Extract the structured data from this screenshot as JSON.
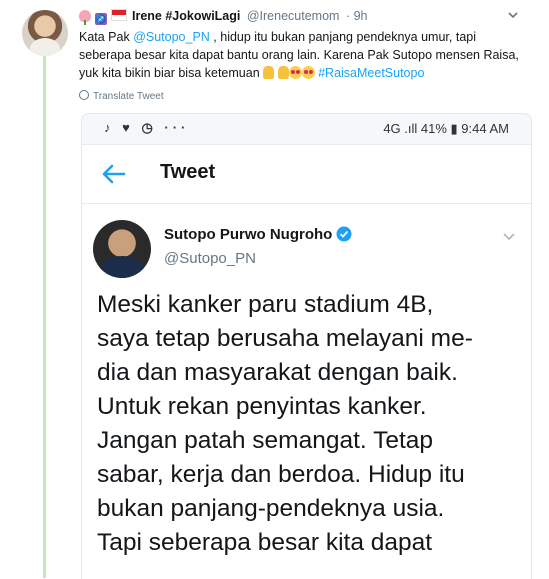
{
  "outer_tweet": {
    "display_name": "Irene #JokowiLagi",
    "handle": "@Irenecutemom",
    "separator_time": "· 9h",
    "text_before_link": "Kata Pak ",
    "mention": "@Sutopo_PN",
    "text_after_link": " , hidup itu bukan panjang pendeknya umur, tapi seberapa besar kita dapat bantu orang lain. Karena Pak Sutopo mensen Raisa, yuk kita bikin biar bisa ketemuan ",
    "hashtag": "#RaisaMeetSutopo",
    "translate_label": "Translate Tweet",
    "name_emojis": [
      "flower-emoji",
      "sagittarius-emoji",
      "indonesia-flag-emoji"
    ],
    "text_emojis": [
      "pray-emoji",
      "pray-emoji",
      "heart-eyes-emoji",
      "heart-eyes-emoji"
    ]
  },
  "screenshot": {
    "status_bar": {
      "left_icons": "♪ ♥ ◷ ···",
      "right_text": "4G .ıll 41% ▮ 9:44 AM"
    },
    "top_bar": {
      "title": "Tweet"
    },
    "tweet": {
      "name": "Sutopo Purwo Nugroho",
      "handle": "@Sutopo_PN",
      "text": "Meski kanker paru stadium 4B,\nsaya tetap berusaha melayani me-\ndia dan masyarakat dengan baik.\nUntuk rekan penyintas kanker.\nJangan patah semangat. Tetap\nsabar, kerja dan berdoa. Hidup itu\nbukan panjang-pendeknya usia.\nTapi  seberapa besar kita dapat"
    }
  },
  "colors": {
    "link": "#1da1f2",
    "thread_line": "#c4e6b8",
    "secondary_text": "#657786"
  }
}
